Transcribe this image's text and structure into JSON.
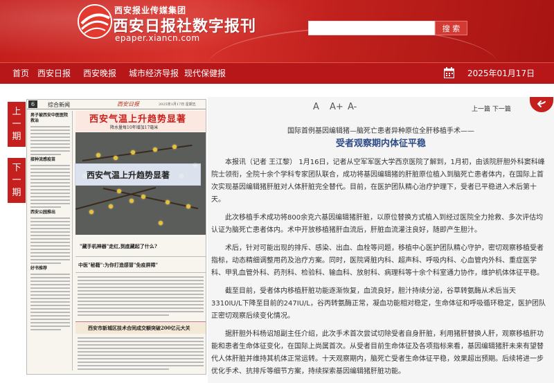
{
  "header": {
    "group_name": "西安报业传媒集团",
    "site_title": "西安日报社数字报刊",
    "site_url": "epaper.xiancn.com",
    "search_placeholder": "",
    "search_button": "搜 索",
    "brand_color": "#c41e1b"
  },
  "nav": {
    "items": [
      "首页",
      "西安日报",
      "西安晚报",
      "城市经济导报",
      "现代保健报"
    ],
    "date": "2025年01月17日"
  },
  "side": {
    "prev_label": [
      "上",
      "一",
      "期"
    ],
    "next_label": [
      "下",
      "一",
      "期"
    ]
  },
  "paper_thumb": {
    "page_no": "6",
    "section": "综合新闻",
    "masthead": "西安日报",
    "date_line": "2025年1月17日 星期五",
    "left_heads": [
      "男子被西安中医医院救治",
      "接种流感疫苗",
      "西安公园推出",
      "好书推荐"
    ],
    "headline": "西安气温上升趋势显著",
    "subhead": "降水量每10年增加17毫米",
    "mid_head": "\"藏手机神器\"走红,到底藏起了什么?",
    "mid_head2": "中医\"秘籍\":为你打造感冒\"免疫屏障\"",
    "bottom_head": "西安市新城区技术合同成交额突破200亿元大关",
    "hover_headline": "西安气温上升趋势显著"
  },
  "article": {
    "font_controls": [
      "A",
      "A+",
      "A-"
    ],
    "pager": "上一篇 下一篇",
    "kicker": "国际首例基因编辑猪—脑死亡患者异种原位全肝移植手术——",
    "title": "受者观察期内体征平稳",
    "paragraphs": [
      "本报讯（记者 王江黎） 1月16日，记者从空军军医大学西京医院了解到，1月初，由该院肝胆外科窦科峰院士领衔，全院十余个学科专家团队联合，成功将基因编辑猪的肝脏原位植入到脑死亡患者体内，在国际上首次实现基因编辑猪肝脏对人体肝脏完全替代。目前，在医护团队精心治疗护理下，受者已平稳进入术后第十天。",
      "此次移植手术成功将800余克六基因编辑猪肝脏，以原位替换方式植入到经过医院全力抢救、多次评估均认证为脑死亡患者体内。术中开放移植猪肝血流后，肝脏血流灌注良好，随即产生胆汁。",
      "术后，针对可能出现的排斥、感染、出血、血栓等问题，移植中心医护团队精心守护，密切观察移植受者指标，动态精细调整用药及治疗方案。同时，医院肾脏内科、超声科、呼吸内科、心血管内外科、重症医学科、甲乳血管外科、药剂科、检验科、输血科、放射科、病理科等十余个科室通力协作，维护机体体征平稳。",
      "截至目前，受者体内移植肝脏功能逐渐恢复，血流良好，胆汁持续分泌，谷草转氨酶从术后当天3310IU/L下降至目前的247IU/L，谷丙转氨酶正常，凝血功能相对稳定，生命体征和呼吸循环稳定，医护团队正密切观察后续变化情况。",
      "据肝胆外科杨诏旭副主任介绍，此次手术首次尝试切除受者自身肝脏，利用猪肝替换人肝，观察移植肝功能和患者生命体征变化，在国际上尚属首次。从受者目前生命体征及各项指标来看，基因编辑猪肝未来有望替代人体肝脏并维持其机体正常运转。十天观察期内，脑死亡受者生命体征平稳，效果超出预期。后续将进一步优化手术、抗排斥等细节方案，持续探索基因编辑猪肝脏功能。"
    ]
  }
}
